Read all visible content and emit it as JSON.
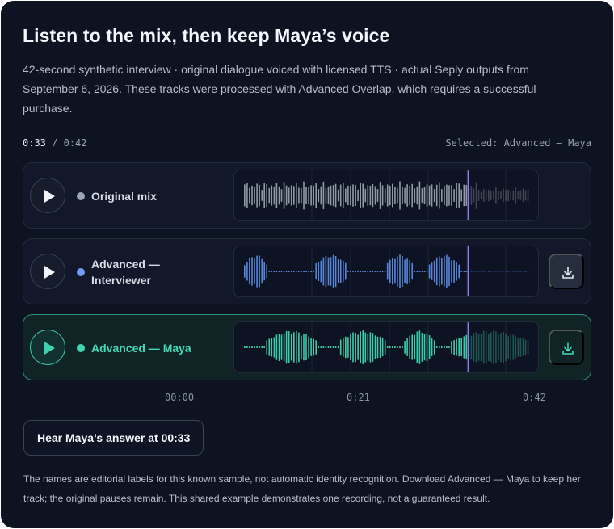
{
  "header": {
    "title": "Listen to the mix, then keep Maya’s voice",
    "description": "42-second synthetic interview · original dialogue voiced with licensed TTS · actual Seply outputs from September 6, 2026. These tracks were processed with Advanced Overlap, which requires a successful purchase."
  },
  "player": {
    "current_time": "0:33",
    "separator": " / ",
    "duration": "0:42",
    "selected_text": "Selected: Advanced — Maya",
    "progress_fraction": 0.786
  },
  "tracks": [
    {
      "label": "Original mix",
      "dot_color": "#9ca3b3",
      "wave_color": "#9aa0ae",
      "selected": false,
      "has_download": false,
      "play_icon": "play-icon",
      "download_icon": null
    },
    {
      "label": "Advanced — Interviewer",
      "dot_color": "#6f9bf2",
      "wave_color": "#5c8de6",
      "selected": false,
      "has_download": true,
      "play_icon": "play-icon",
      "download_icon": "download-icon"
    },
    {
      "label": "Advanced — Maya",
      "dot_color": "#3fd6b0",
      "wave_color": "#3fd6b0",
      "selected": true,
      "has_download": true,
      "play_icon": "play-icon",
      "download_icon": "download-icon"
    }
  ],
  "axis": [
    "00:00",
    "0:21",
    "0:42"
  ],
  "action": {
    "button_label": "Hear Maya’s answer at 00:33"
  },
  "footnote": "The names are editorial labels for this known sample, not automatic identity recognition. Download Advanced — Maya to keep her track; the original pauses remain. This shared example demonstrates one recording, not a guaranteed result.",
  "colors": {
    "background": "#0e1322",
    "accent": "#3fd6b0",
    "playhead": "#8b7cf0"
  }
}
